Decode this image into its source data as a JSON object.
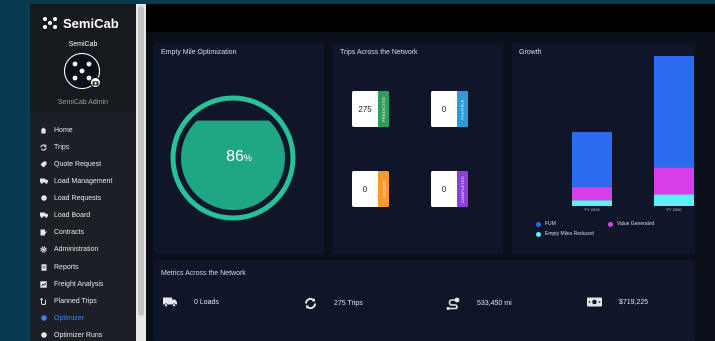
{
  "app": {
    "brand": "SemiCab",
    "org_name": "SemiCab",
    "user_name": "SemiCab Admin"
  },
  "sidebar": {
    "items": [
      {
        "label": "Home",
        "icon": "home-icon"
      },
      {
        "label": "Trips",
        "icon": "refresh-icon"
      },
      {
        "label": "Quote Request",
        "icon": "tag-icon"
      },
      {
        "label": "Load Management",
        "icon": "truck-icon"
      },
      {
        "label": "Load Requests",
        "icon": "circle-icon"
      },
      {
        "label": "Load Board",
        "icon": "truck-icon"
      },
      {
        "label": "Contracts",
        "icon": "document-edit-icon"
      },
      {
        "label": "Administration",
        "icon": "gear-icon"
      },
      {
        "label": "Reports",
        "icon": "document-icon"
      },
      {
        "label": "Freight Analysis",
        "icon": "chart-icon"
      },
      {
        "label": "Planned Trips",
        "icon": "route-icon"
      },
      {
        "label": "Optimizer",
        "icon": "circle-icon",
        "active": true
      },
      {
        "label": "Optimizer Runs",
        "icon": "circle-icon"
      }
    ]
  },
  "empty_mile": {
    "title": "Empty Mile Optimization",
    "value": "86",
    "unit": "%",
    "fill_fraction": 0.86
  },
  "trips": {
    "title": "Trips Across the Network",
    "boxes": [
      {
        "value": "275",
        "tag": "PREDICTED",
        "color": "#2e9e5b"
      },
      {
        "value": "0",
        "tag": "FLEXIBLE",
        "color": "#2e9bd6"
      },
      {
        "value": "0",
        "tag": "LOCKED",
        "color": "#f59a2c"
      },
      {
        "value": "0",
        "tag": "COMPLETED",
        "color": "#8a3fd6"
      }
    ]
  },
  "growth": {
    "title": "Growth",
    "legend": [
      {
        "label": "FUM",
        "color": "#2c6bf0"
      },
      {
        "label": "Value Generated",
        "color": "#d63fe8"
      },
      {
        "label": "Empty Miles Reduced",
        "color": "#5ff0f5"
      }
    ],
    "chart_data": {
      "type": "bar",
      "categories": [
        "FY 2019",
        "FY 2020"
      ],
      "series": [
        {
          "name": "Empty Miles Reduced",
          "values": [
            6,
            12
          ]
        },
        {
          "name": "Value Generated",
          "values": [
            14,
            28
          ]
        },
        {
          "name": "FUM",
          "values": [
            57,
            116
          ]
        }
      ],
      "stacked": true,
      "ylim": [
        0,
        156
      ]
    }
  },
  "metrics": {
    "title": "Metrics Across the Network",
    "items": [
      {
        "label": "0 Loads",
        "icon": "truck-icon"
      },
      {
        "label": "275 Trips",
        "icon": "refresh-icon"
      },
      {
        "label": "533,450 mi",
        "icon": "route-icon"
      },
      {
        "label": "$719,225",
        "icon": "money-icon"
      }
    ]
  }
}
